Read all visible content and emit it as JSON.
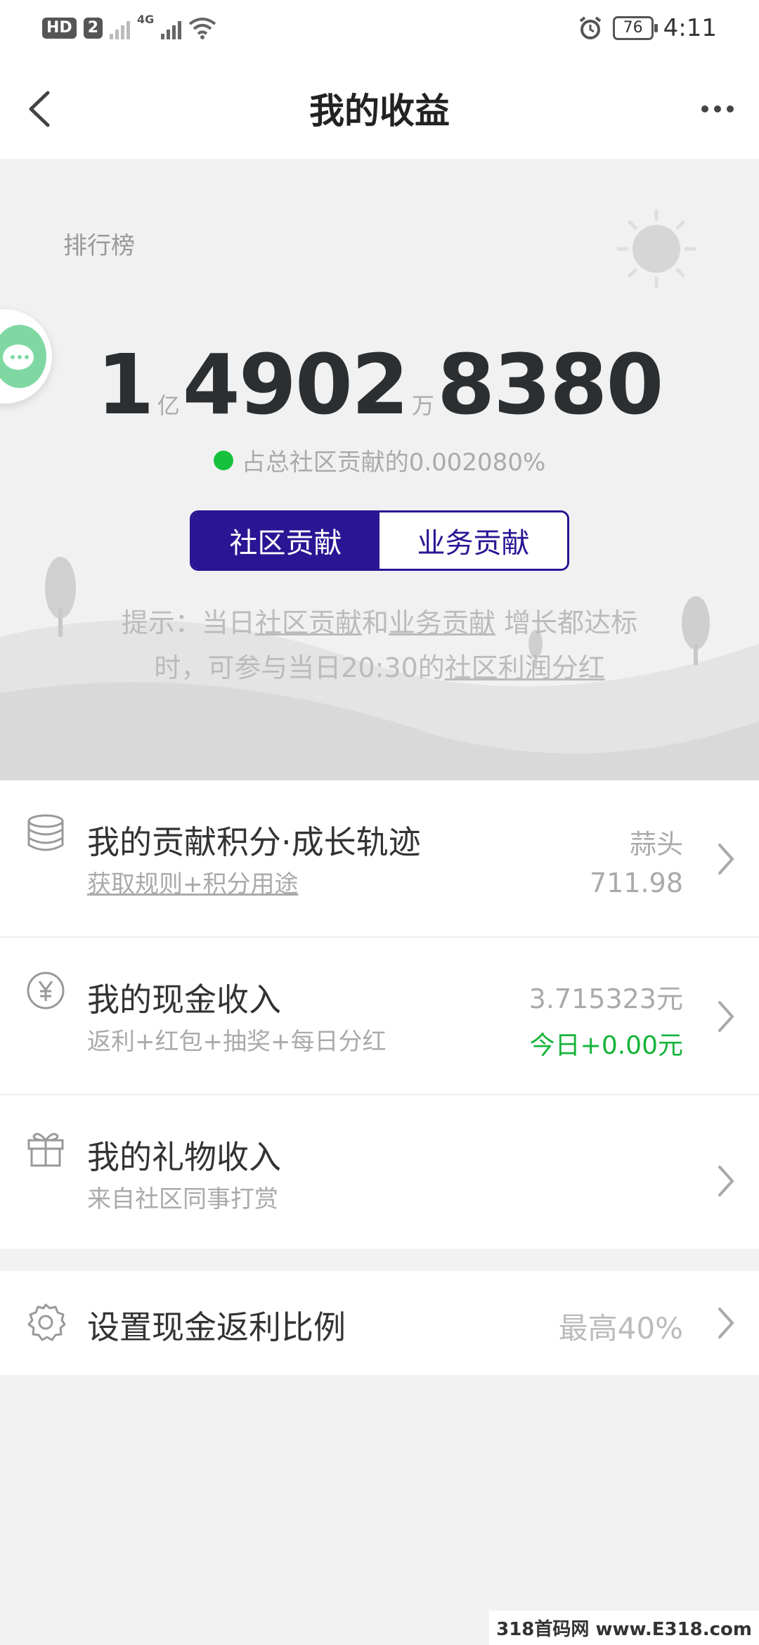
{
  "status_bar": {
    "hd_label": "HD",
    "sim_label": "2",
    "net_label": "4G",
    "battery": "76",
    "time": "4:11"
  },
  "nav": {
    "title": "我的收益",
    "back_icon": "chevron-left-icon",
    "more_icon": "more-dots-icon"
  },
  "hero": {
    "rank_label": "排行榜",
    "amount_parts": [
      "1",
      "4902",
      "8380"
    ],
    "units": [
      "亿",
      "万"
    ],
    "share_text": "占总社区贡献的0.002080%",
    "tabs": [
      "社区贡献",
      "业务贡献"
    ],
    "active_tab": "社区贡献",
    "tip": {
      "p1": "提示：当日",
      "link1": "社区贡献",
      "p2": "和",
      "link2": "业务贡献",
      "p3": " 增长都达标时，可参与当日20:30的",
      "link3": "社区利润分红"
    },
    "accent_color": "#2a1594",
    "status_dot_color": "#16c23b"
  },
  "items": [
    {
      "icon": "coins-stack-icon",
      "title": "我的贡献积分·成长轨迹",
      "subtitle": "获取规则+积分用途",
      "right_label": "蒜头",
      "right_value": "711.98"
    },
    {
      "icon": "yen-circle-icon",
      "title": "我的现金收入",
      "subtitle": "返利+红包+抽奖+每日分红",
      "right_value": "3.715323元",
      "right_today": "今日+0.00元"
    },
    {
      "icon": "gift-icon",
      "title": "我的礼物收入",
      "subtitle": "来自社区同事打赏"
    }
  ],
  "settings": {
    "icon": "gear-icon",
    "title": "设置现金返利比例",
    "value": "最高40%"
  },
  "watermark": "318首码网 www.E318.com"
}
